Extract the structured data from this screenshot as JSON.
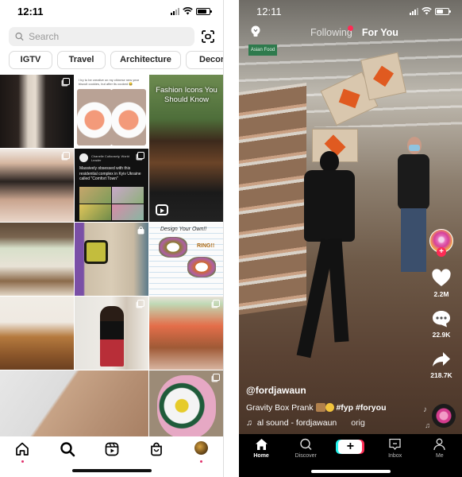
{
  "instagram": {
    "status": {
      "time": "12:11"
    },
    "search": {
      "placeholder": "Search",
      "value": ""
    },
    "chips": [
      "IGTV",
      "Travel",
      "Architecture",
      "Decor"
    ],
    "grid": {
      "tile_2_caption": "I try to be creative on my chinese new year biscuit cookies, but after its cooked 😂",
      "tile_3_title": "Fashion Icons You Should Know",
      "tile_5": {
        "author": "Chanelle Cutloosely, World Leader",
        "text": "Massively obsessed with this residential complex in Kyiv Ukraine called \"Comfort Town\""
      },
      "tile_8": {
        "heading": "Design Your Own!!",
        "subheading": "RING!!"
      }
    },
    "tabbar": [
      {
        "name": "home",
        "icon": "home-icon",
        "notification": true
      },
      {
        "name": "search",
        "icon": "search-icon",
        "active": true
      },
      {
        "name": "reels",
        "icon": "reels-icon"
      },
      {
        "name": "shop",
        "icon": "shopping-bag-icon"
      },
      {
        "name": "profile",
        "icon": "avatar",
        "notification": true
      }
    ]
  },
  "tiktok": {
    "status": {
      "time": "12:11"
    },
    "top_tabs": {
      "following": "Following",
      "for_you": "For You",
      "active": "For You"
    },
    "sign_text": "Asian Food",
    "actions": {
      "likes": "2.2M",
      "comments": "22.9K",
      "shares": "218.7K"
    },
    "caption": {
      "username": "@fordjawaun",
      "description": "Gravity Box Prank",
      "hashtags": "#fyp #foryou",
      "sound": "al sound - fordjawaun",
      "sound_suffix": "orig"
    },
    "tabbar": {
      "home": "Home",
      "discover": "Discover",
      "create": "+",
      "inbox": "Inbox",
      "me": "Me"
    },
    "colors": {
      "accent_red": "#fe2c55",
      "accent_cyan": "#25f4ee"
    }
  }
}
